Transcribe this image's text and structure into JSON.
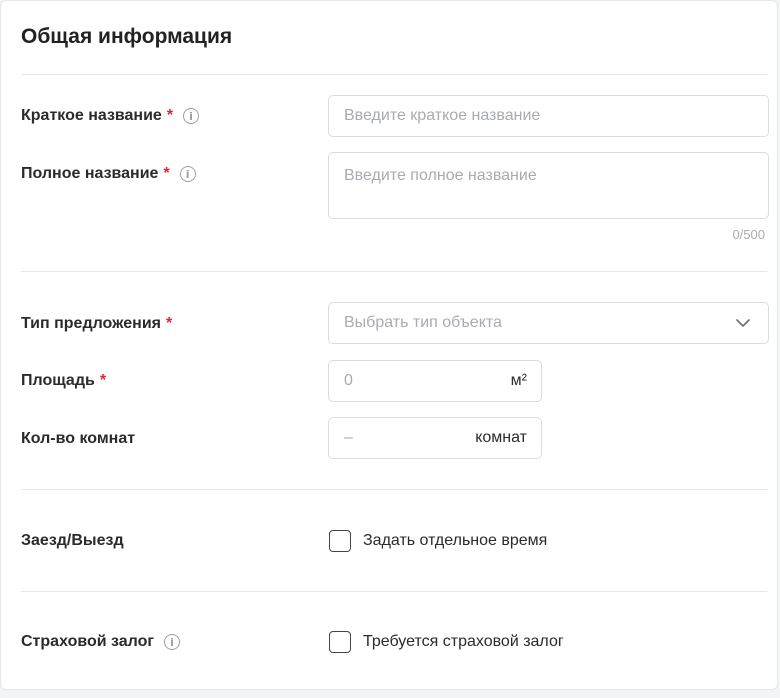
{
  "section": {
    "title": "Общая информация"
  },
  "fields": {
    "short_name": {
      "label": "Краткое название",
      "required": "*",
      "info_icon": "i",
      "placeholder": "Введите краткое название"
    },
    "full_name": {
      "label": "Полное название",
      "required": "*",
      "info_icon": "i",
      "placeholder": "Введите полное название",
      "counter": "0/500"
    },
    "offer_type": {
      "label": "Тип предложения",
      "required": "*",
      "placeholder": "Выбрать тип объекта"
    },
    "area": {
      "label": "Площадь",
      "required": "*",
      "value": "0",
      "unit": "м²"
    },
    "rooms": {
      "label": "Кол-во комнат",
      "value": "–",
      "unit": "комнат"
    },
    "checkin": {
      "label": "Заезд/Выезд",
      "checkbox_label": "Задать отдельное время"
    },
    "deposit": {
      "label": "Страховой залог",
      "info_icon": "i",
      "checkbox_label": "Требуется страховой залог"
    }
  },
  "icons": {
    "info": "info-circle-icon",
    "dropdown": "chevron-down-icon"
  },
  "colors": {
    "required": "#e3262c",
    "border": "#d9dce1",
    "placeholder": "#a8abb1"
  }
}
